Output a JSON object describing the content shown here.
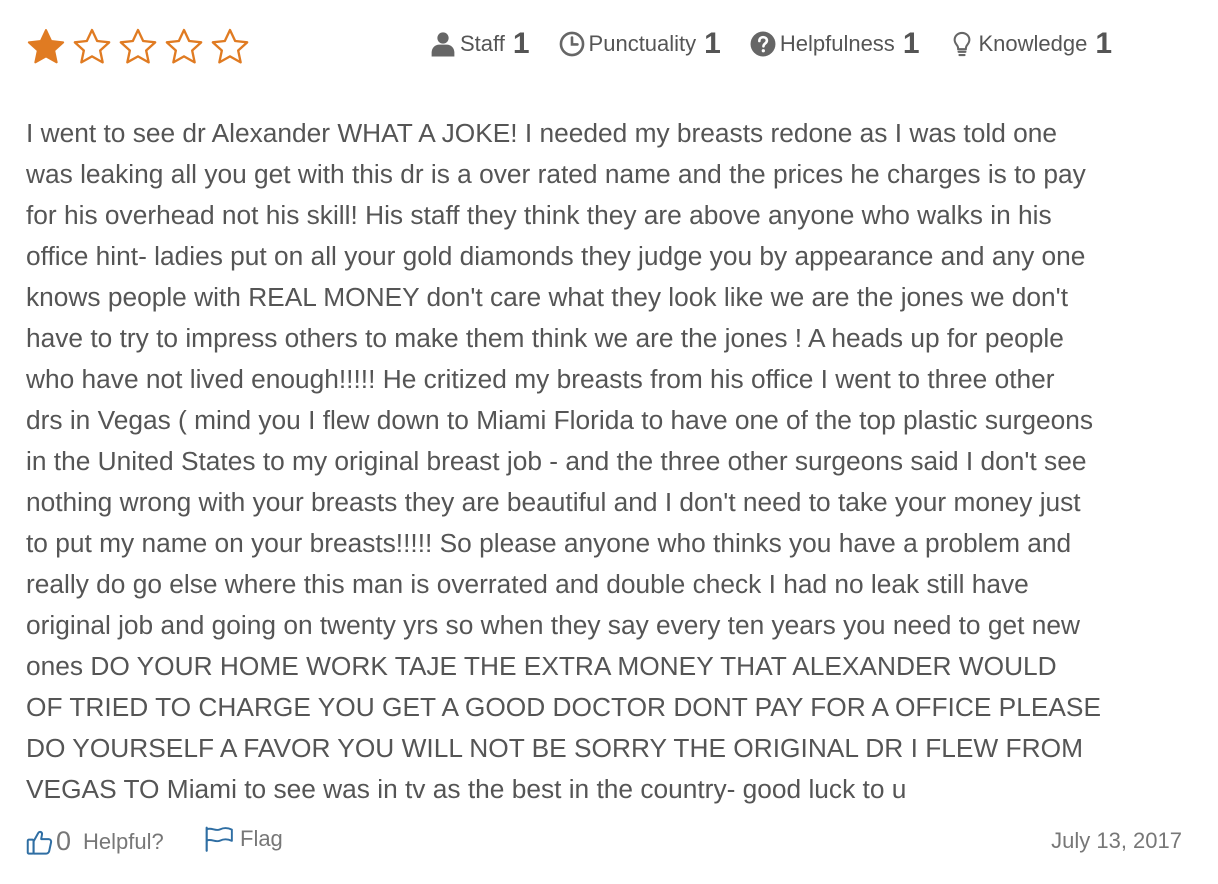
{
  "rating": {
    "stars_filled": 1,
    "stars_total": 5,
    "star_color": "#e07b22",
    "categories": [
      {
        "label": "Staff",
        "value": "1",
        "icon": "user-icon"
      },
      {
        "label": "Punctuality",
        "value": "1",
        "icon": "clock-icon"
      },
      {
        "label": "Helpfulness",
        "value": "1",
        "icon": "question-circle-icon"
      },
      {
        "label": "Knowledge",
        "value": "1",
        "icon": "lightbulb-icon"
      }
    ]
  },
  "review": {
    "lines": [
      "I went to see dr Alexander WHAT A JOKE! I needed my breasts redone as I was told one",
      "was leaking all you get with this dr is a over rated name and the prices he charges is to pay",
      "for his overhead not his skill! His staff they think they are above anyone who walks in his",
      "office hint- ladies put on all your gold diamonds they judge you by appearance and any one",
      "knows people with REAL MONEY don't care what they look like we are the jones we don't",
      "have to try to impress others to make them think we are the jones ! A heads up for people",
      "who have not lived enough!!!!! He critized my breasts from his office I went to three other",
      "drs in Vegas ( mind you I flew down to Miami Florida to have one of the top plastic surgeons",
      "in the United States to my original breast job - and the three other surgeons said I don't see",
      "nothing wrong with your breasts they are beautiful and I don't need to take your money just",
      "to put my name on your breasts!!!!! So please anyone who thinks you have a problem and",
      "really do go else where this man is overrated and double check I had no leak still have",
      "original job and going on twenty yrs so when they say every ten years you need to get new",
      "ones DO YOUR HOME WORK TAJE THE EXTRA MONEY THAT ALEXANDER WOULD",
      "OF TRIED TO CHARGE YOU GET A GOOD DOCTOR DONT PAY FOR A OFFICE PLEASE",
      "DO YOURSELF A FAVOR YOU WILL NOT BE SORRY THE ORIGINAL DR I FLEW FROM",
      "VEGAS TO Miami to see was in tv as the best in the country- good luck to u"
    ]
  },
  "footer": {
    "helpful_count": "0",
    "helpful_label": "Helpful?",
    "flag_label": "Flag",
    "date": "July 13, 2017"
  }
}
